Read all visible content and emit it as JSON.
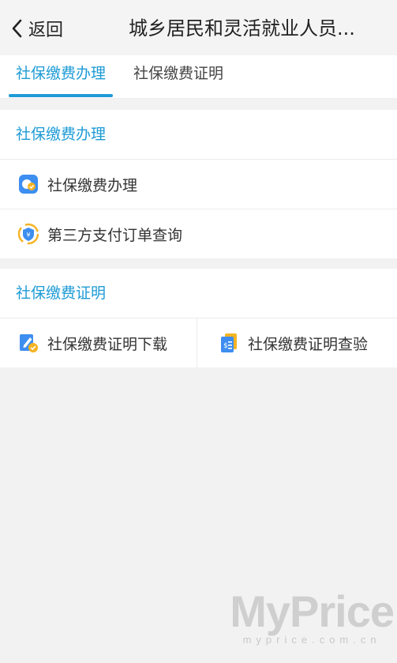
{
  "header": {
    "back_label": "返回",
    "title": "城乡居民和灵活就业人员..."
  },
  "tabs": [
    {
      "label": "社保缴费办理",
      "active": true
    },
    {
      "label": "社保缴费证明",
      "active": false
    }
  ],
  "section_payment": {
    "title": "社保缴费办理",
    "items": [
      {
        "label": "社保缴费办理",
        "icon": "payment-app-icon"
      },
      {
        "label": "第三方支付订单查询",
        "icon": "third-party-payment-icon"
      }
    ]
  },
  "section_certificate": {
    "title": "社保缴费证明",
    "items": [
      {
        "label": "社保缴费证明下载",
        "icon": "certificate-download-icon"
      },
      {
        "label": "社保缴费证明查验",
        "icon": "certificate-verify-icon"
      }
    ]
  },
  "watermark": {
    "brand": "MyPrice",
    "site": "myprice.com.cn"
  },
  "colors": {
    "accent": "#1d9bd6",
    "background": "#f2f2f2"
  }
}
